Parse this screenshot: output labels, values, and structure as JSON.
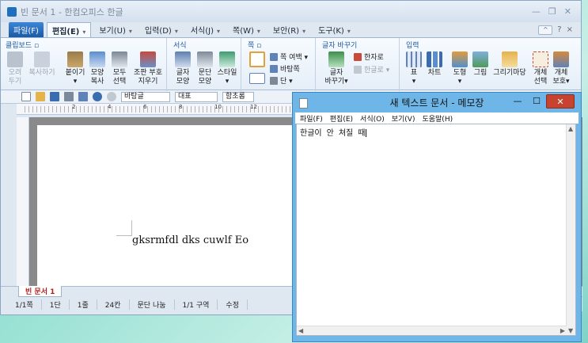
{
  "hwp": {
    "title": "빈 문서 1 - 한컴오피스 한글",
    "window_controls": [
      "—",
      "❐",
      "✕"
    ],
    "menus": {
      "file": "파일(F)",
      "edit": "편집(E)",
      "view": "보기(U)",
      "insert": "입력(D)",
      "format": "서식(J)",
      "page": "쪽(W)",
      "security": "보안(R)",
      "tools": "도구(K)"
    },
    "menu_right": [
      "^",
      "?",
      "×"
    ],
    "ribbon": {
      "groups": {
        "clipboard": "클립보드 ▫",
        "format": "서식",
        "page": "쪽 ▫",
        "char_change": "글자 바꾸기",
        "insert": "입력"
      },
      "clipboard": {
        "cut": [
          "오려",
          "두기"
        ],
        "copy": [
          "복사하기",
          ""
        ],
        "paste": [
          "붙이기",
          "▾"
        ],
        "copy_shape": [
          "모양",
          "복사"
        ],
        "select_all": [
          "모두",
          "선택"
        ],
        "remove_combo": [
          "조판 부호",
          "지우기"
        ]
      },
      "format": {
        "char_shape": [
          "글자",
          "모양"
        ],
        "para_shape": [
          "문단",
          "모양"
        ],
        "style": [
          "스타일",
          "▾"
        ]
      },
      "page": {
        "margin": "쪽 여백 ▾",
        "background": "바탕쪽",
        "columns": "단 ▾"
      },
      "chars": {
        "hanja": "한자로",
        "hangul": "한글로 ▾",
        "change": [
          "글자",
          "바꾸기▾"
        ]
      },
      "insert": {
        "table": [
          "표",
          "▾"
        ],
        "chart": [
          "차트",
          ""
        ],
        "shape": [
          "도형",
          "▾"
        ],
        "picture": [
          "그림",
          ""
        ],
        "gallery": [
          "그리기마당",
          ""
        ],
        "object_select": [
          "개체",
          "선택"
        ],
        "object_protect": [
          "개체",
          "보호▾"
        ]
      }
    },
    "toolbar2": {
      "style_combo": "바탕글",
      "font_combo": "대표",
      "font2_combo": "함초롬"
    },
    "ruler_numbers": [
      "2",
      "4",
      "6",
      "8",
      "10",
      "12"
    ],
    "document_text": "gksrmfdl dks cuwlf Eo",
    "sheet_tab": "빈 문서 1",
    "status": [
      "1/1쪽",
      "1단",
      "1줄",
      "24칸",
      "문단 나눔",
      "1/1 구역",
      "수정"
    ]
  },
  "notepad": {
    "title": "새 텍스트 문서 - 메모장",
    "controls": [
      "—",
      "☐",
      "✕"
    ],
    "menus": [
      "파일(F)",
      "편집(E)",
      "서식(O)",
      "보기(V)",
      "도움말(H)"
    ],
    "content": "한글이 안 쳐질 때"
  },
  "colors": {
    "desktop": "#9ee3d6",
    "hwp_frame": "#dfe7f0",
    "notepad_frame": "#6fb6e8",
    "close_button": "#c7432f",
    "file_menu": "#1a5aa6"
  }
}
